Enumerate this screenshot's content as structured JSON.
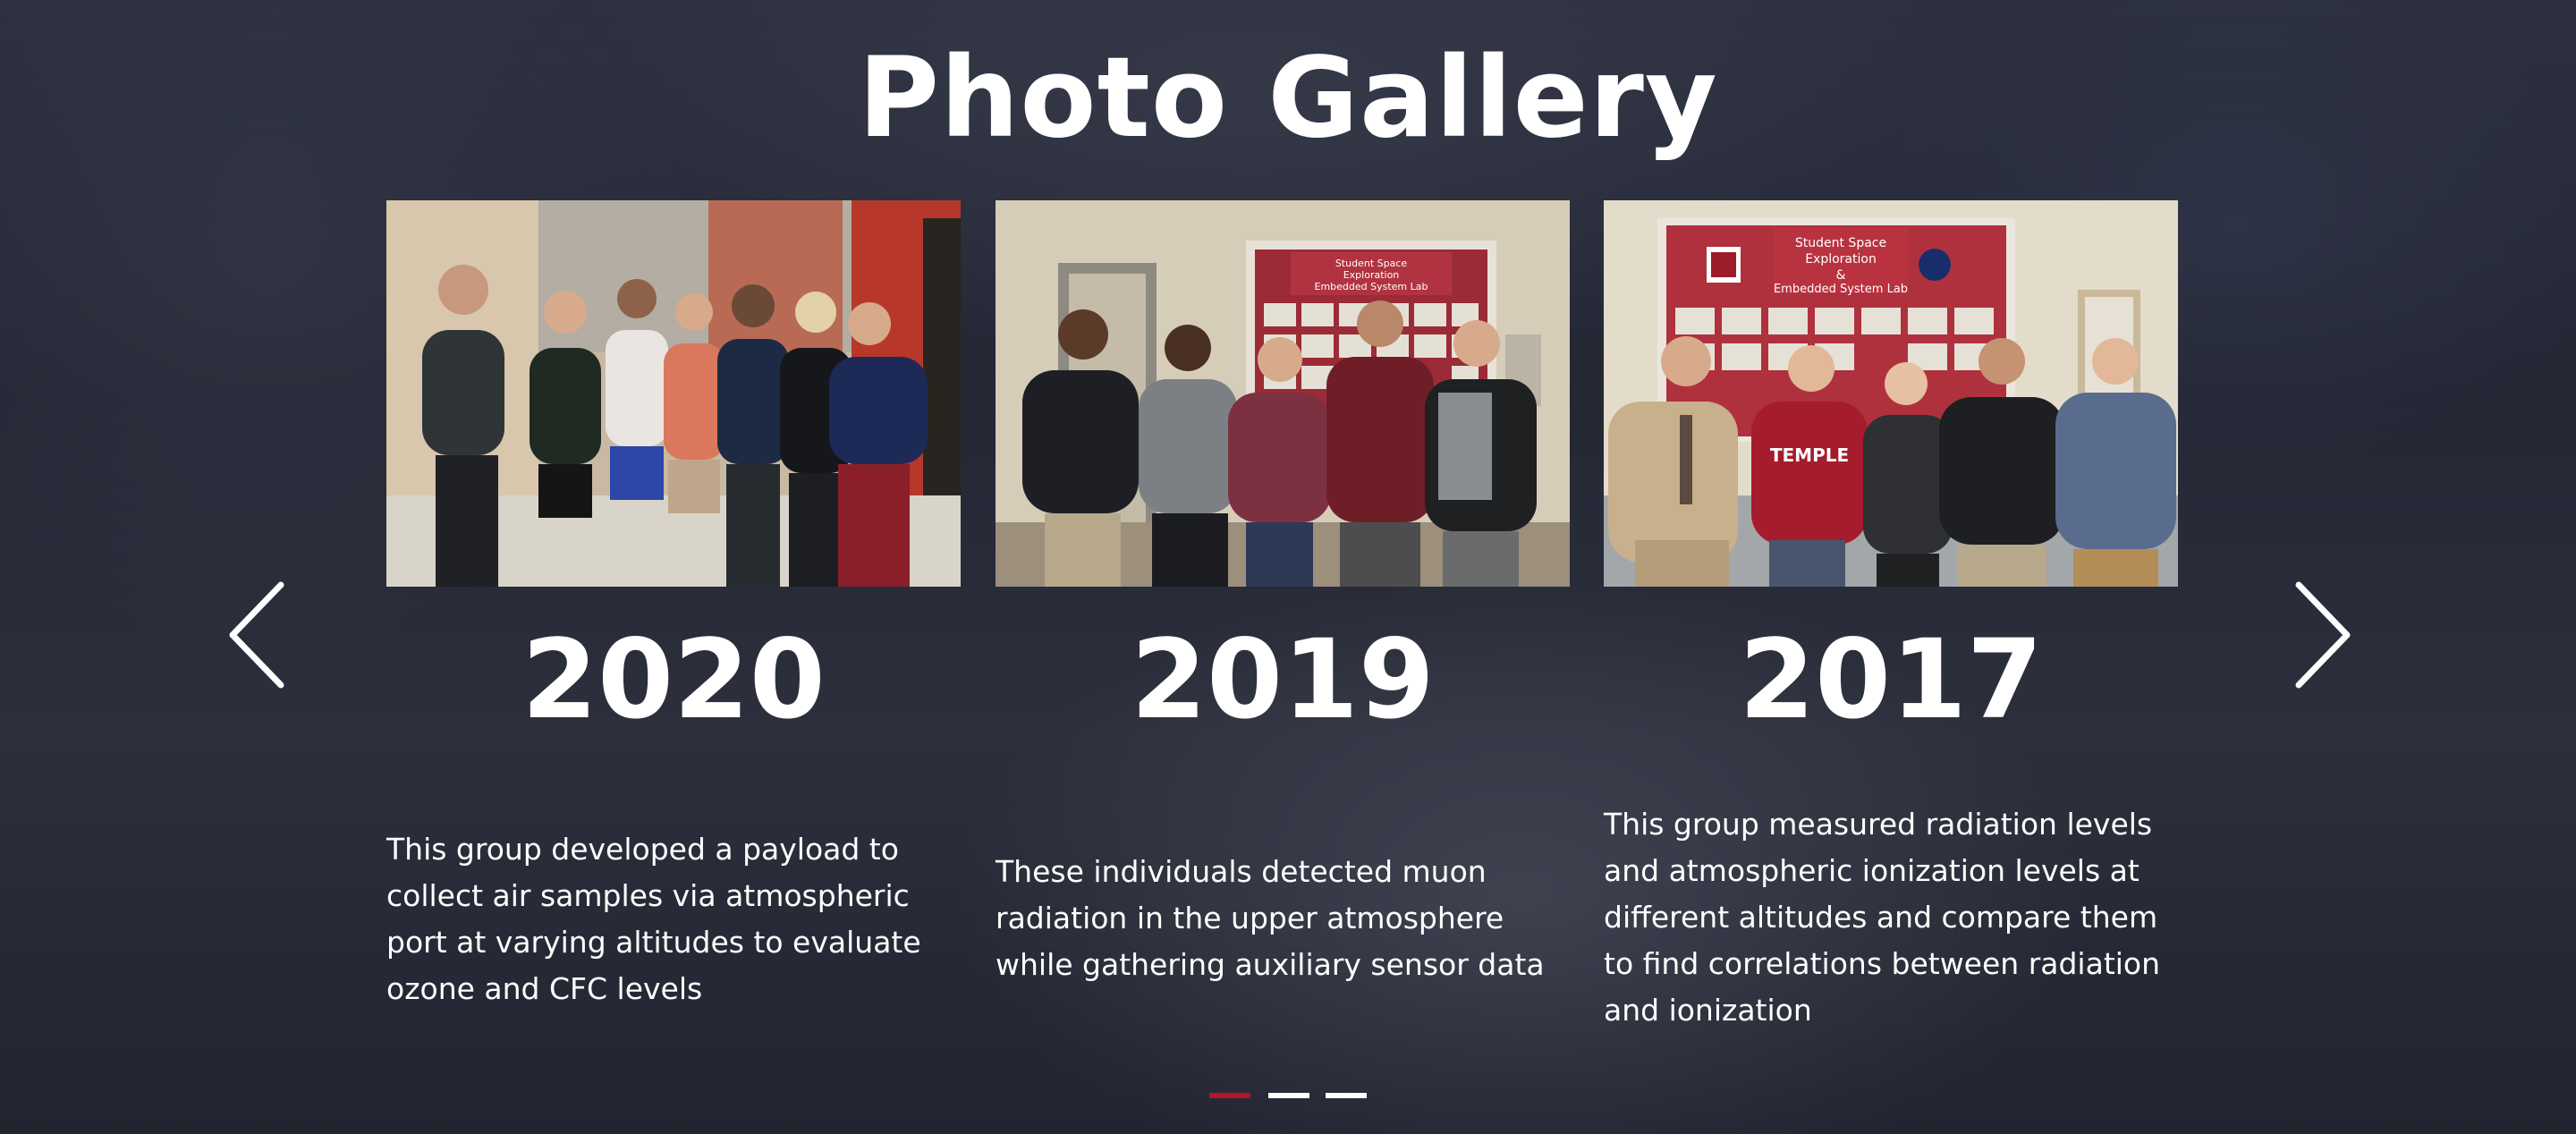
{
  "page": {
    "title": "Photo Gallery"
  },
  "slides": [
    {
      "year": "2020",
      "caption": "This group developed a payload to collect air samples via atmospheric port at varying altitudes to evaluate ozone and CFC levels",
      "image_alt": "2020 team photo"
    },
    {
      "year": "2019",
      "caption": "These individuals detected muon radiation in the upper atmosphere while gathering auxiliary sensor data",
      "image_alt": "2019 team photo",
      "poster_lines": [
        "Student Space",
        "Exploration",
        "&",
        "Embedded System Lab"
      ]
    },
    {
      "year": "2017",
      "caption": "This group measured radiation levels and atmospheric ionization levels at different altitudes and compare them to find correlations between radiation and ionization",
      "image_alt": "2017 team photo",
      "poster_lines": [
        "Student Space",
        "Exploration",
        "&",
        "Embedded System Lab"
      ],
      "shirt_text": "TEMPLE"
    }
  ],
  "navigation": {
    "prev_icon": "chevron-left-icon",
    "next_icon": "chevron-right-icon"
  },
  "pagination": {
    "count": 3,
    "active_index": 0,
    "active_color": "#b5132b",
    "inactive_color": "#ffffff"
  },
  "colors": {
    "text": "#ffffff",
    "accent": "#b5132b"
  }
}
